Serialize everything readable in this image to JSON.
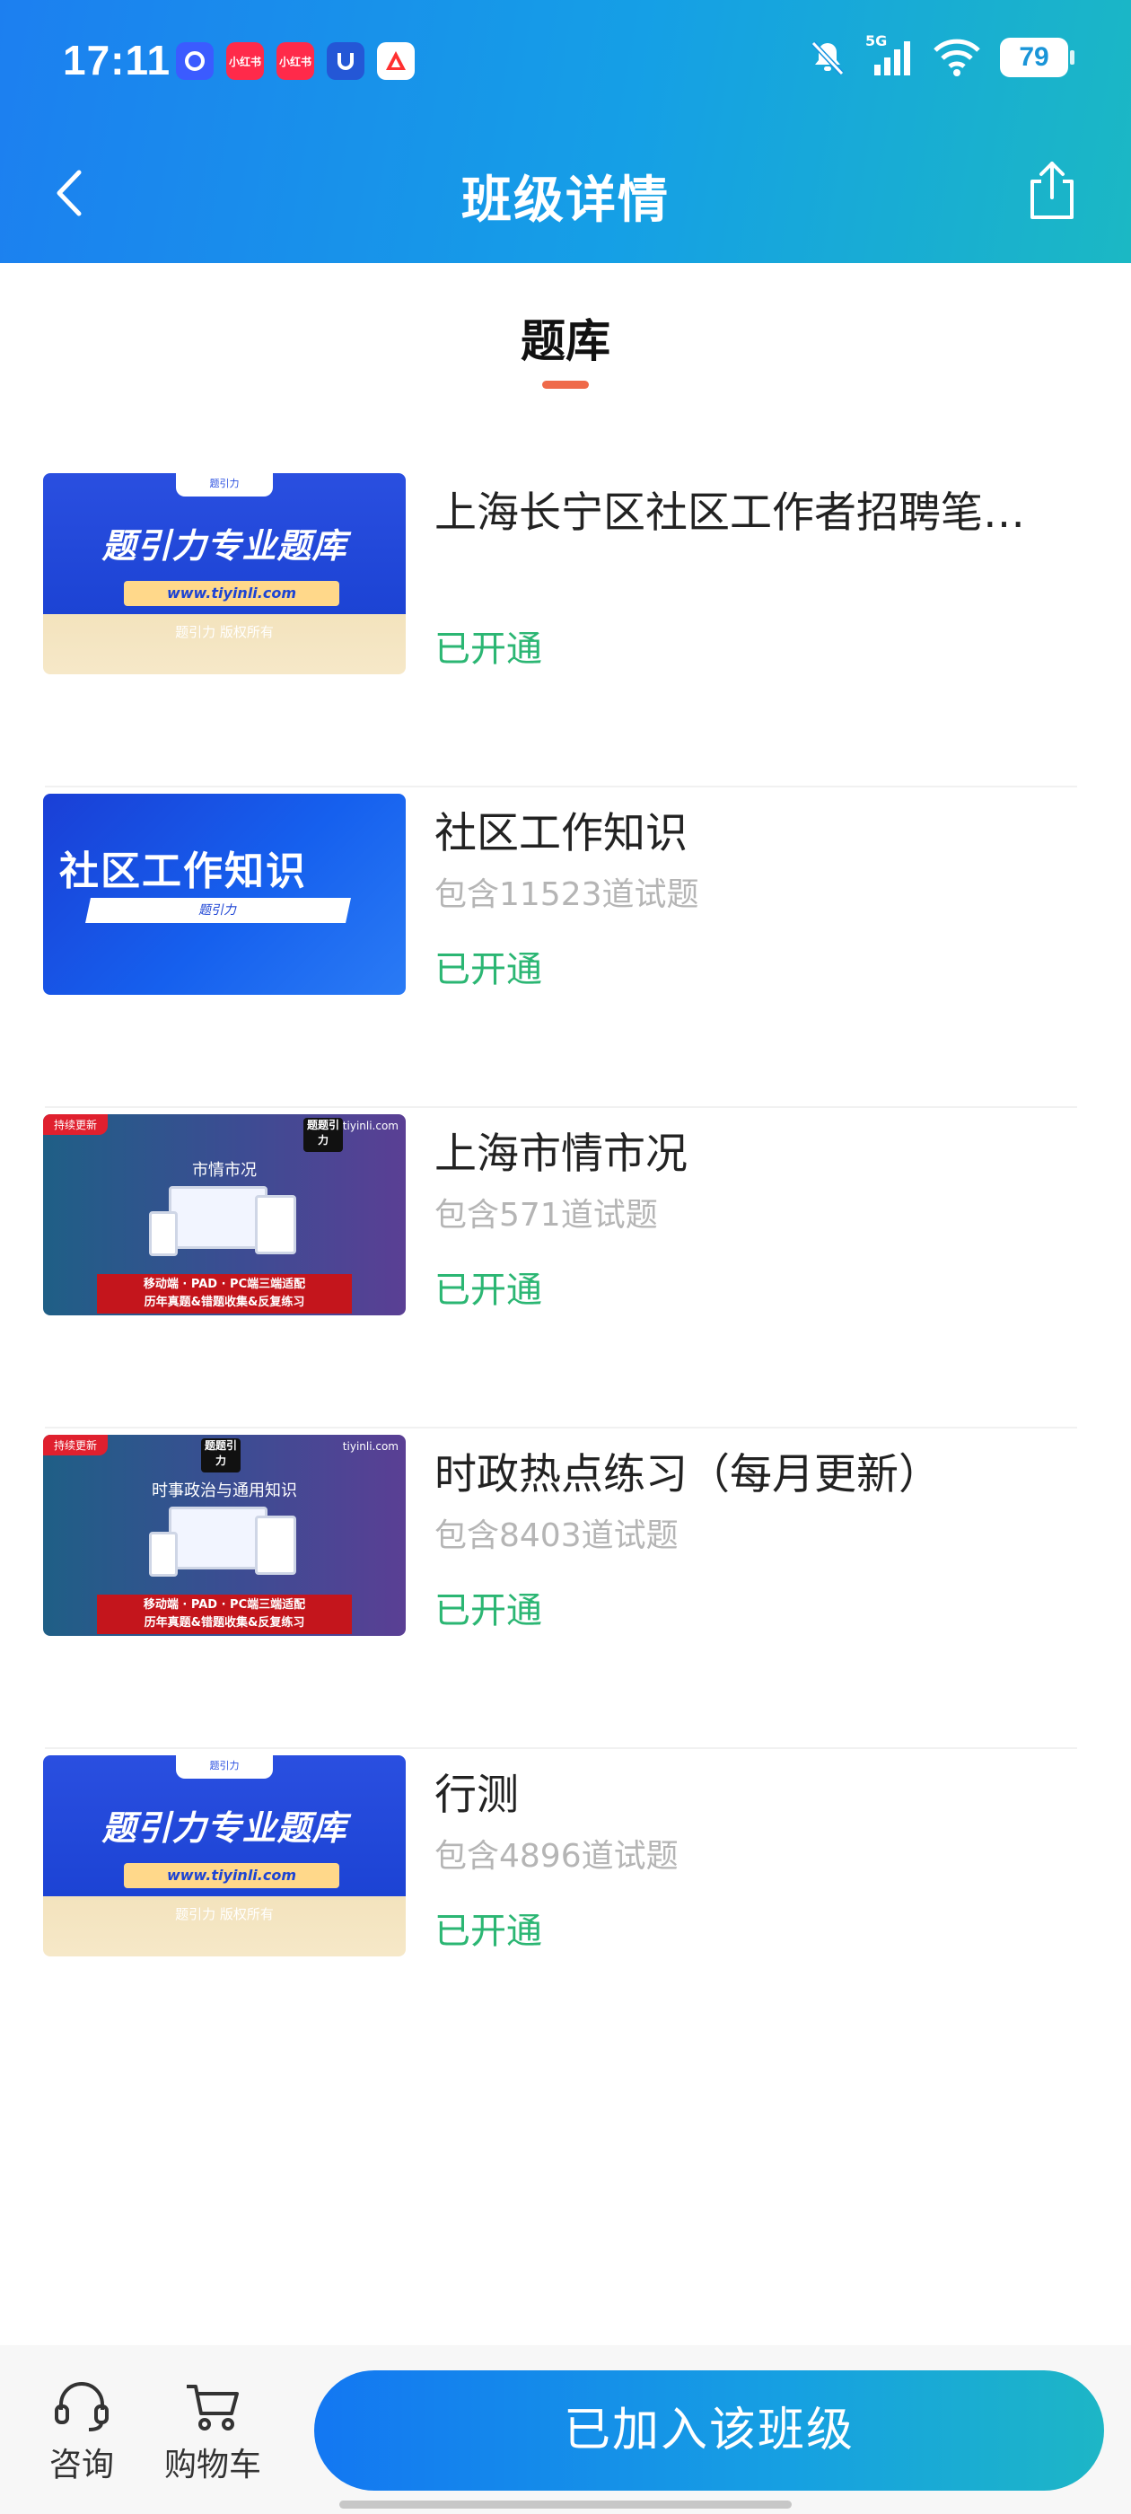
{
  "status_bar": {
    "time": "17:11",
    "app_icons": [
      "app-1",
      "小红书",
      "小红书",
      "app-4",
      "app-5"
    ],
    "network": "5G",
    "battery": "79"
  },
  "nav": {
    "title": "班级详情"
  },
  "section": {
    "tab_label": "题库"
  },
  "banners": {
    "brand": "题引力",
    "headline": "题引力专业题库",
    "url": "www.tiyinli.com",
    "copyright": "题引力 版权所有",
    "knowledge": "社区工作知识",
    "tag": "持续更新",
    "site": "tiyinli.com",
    "logo": "题题引力",
    "heading_city": "市情市况",
    "heading_politics": "时事政治与通用知识",
    "red_line1": "移动端 · PAD · PC端三端适配",
    "red_line2": "历年真题&错题收集&反复练习"
  },
  "items": [
    {
      "title": "上海长宁区社区工作者招聘笔…",
      "count": "",
      "status": "已开通"
    },
    {
      "title": "社区工作知识",
      "count": "包含11523道试题",
      "status": "已开通"
    },
    {
      "title": "上海市情市况",
      "count": "包含571道试题",
      "status": "已开通"
    },
    {
      "title": "时政热点练习（每月更新）",
      "count": "包含8403道试题",
      "status": "已开通"
    },
    {
      "title": "行测",
      "count": "包含4896道试题",
      "status": "已开通"
    }
  ],
  "bottom_bar": {
    "consult_label": "咨询",
    "cart_label": "购物车",
    "join_label": "已加入该班级"
  },
  "colors": {
    "header_start": "#1c7ff0",
    "header_end": "#1bb8c4",
    "status_green": "#2bb673",
    "tab_accent": "#ef6a4a"
  }
}
